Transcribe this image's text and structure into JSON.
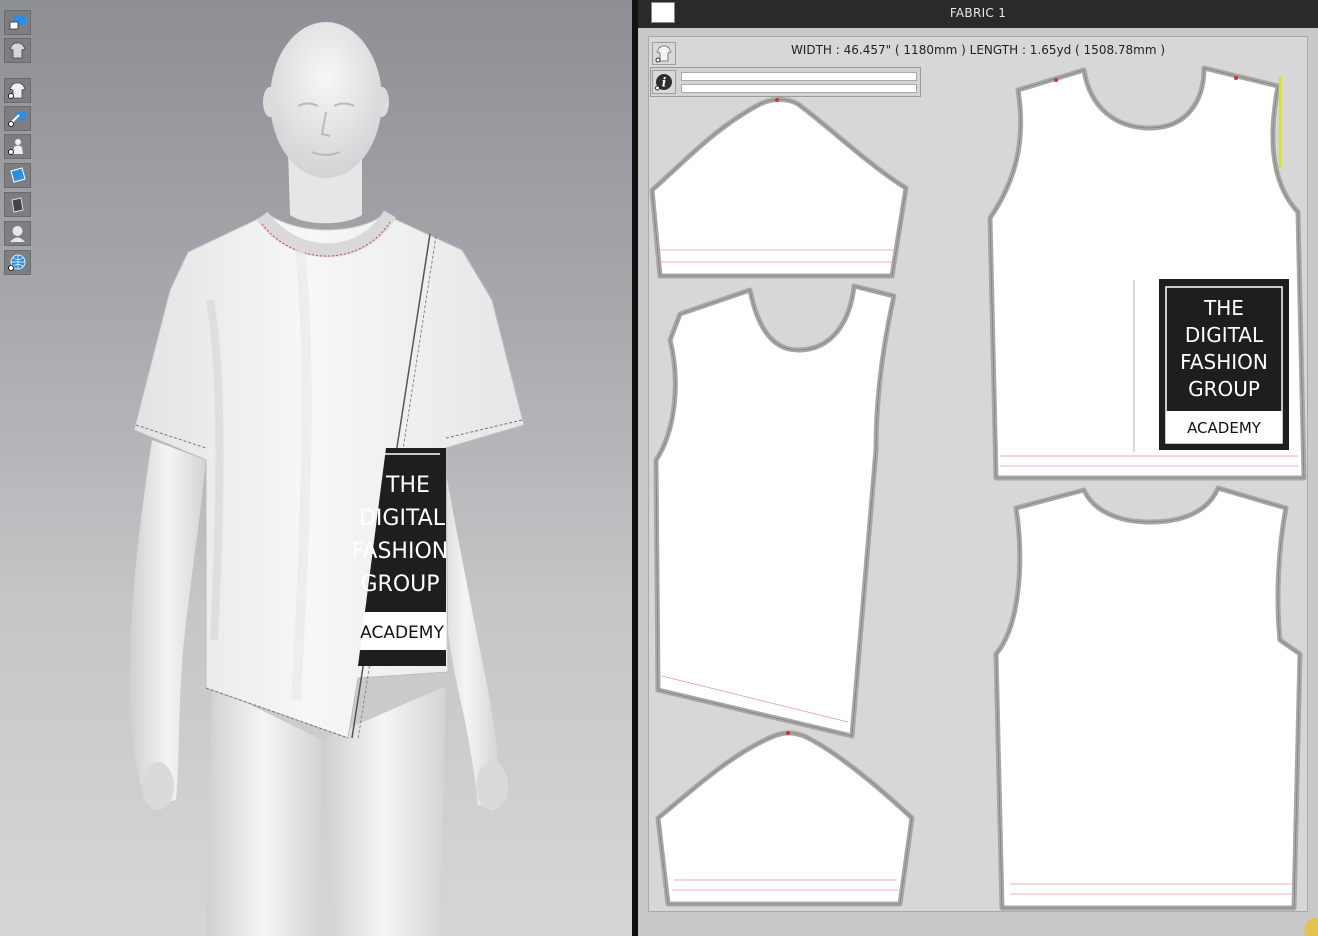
{
  "viewport": {
    "tools": [
      {
        "name": "show-3d-garment-icon"
      },
      {
        "name": "garment-texture-icon"
      },
      {
        "name": "show-garment-icon"
      },
      {
        "name": "pin-tool-icon"
      },
      {
        "name": "show-avatar-icon"
      },
      {
        "name": "fabric-surface-icon"
      },
      {
        "name": "arrangement-plane-icon"
      },
      {
        "name": "avatar-silhouette-icon"
      },
      {
        "name": "globe-environment-icon"
      }
    ],
    "print_lines": [
      "THE",
      "DIGITAL",
      "FASHION",
      "GROUP"
    ],
    "print_sub": "ACADEMY"
  },
  "pattern_window": {
    "title": "FABRIC 1",
    "swatch_color": "#ffffff",
    "dimensions": "WIDTH : 46.457\" ( 1180mm )    LENGTH : 1.65yd ( 1508.78mm )",
    "print_lines": [
      "THE",
      "DIGITAL",
      "FASHION",
      "GROUP"
    ],
    "print_sub": "ACADEMY"
  },
  "colors": {
    "print_black": "#1f1e1e",
    "seam_red": "#d04040",
    "selection_yellow": "#d7e61a"
  }
}
